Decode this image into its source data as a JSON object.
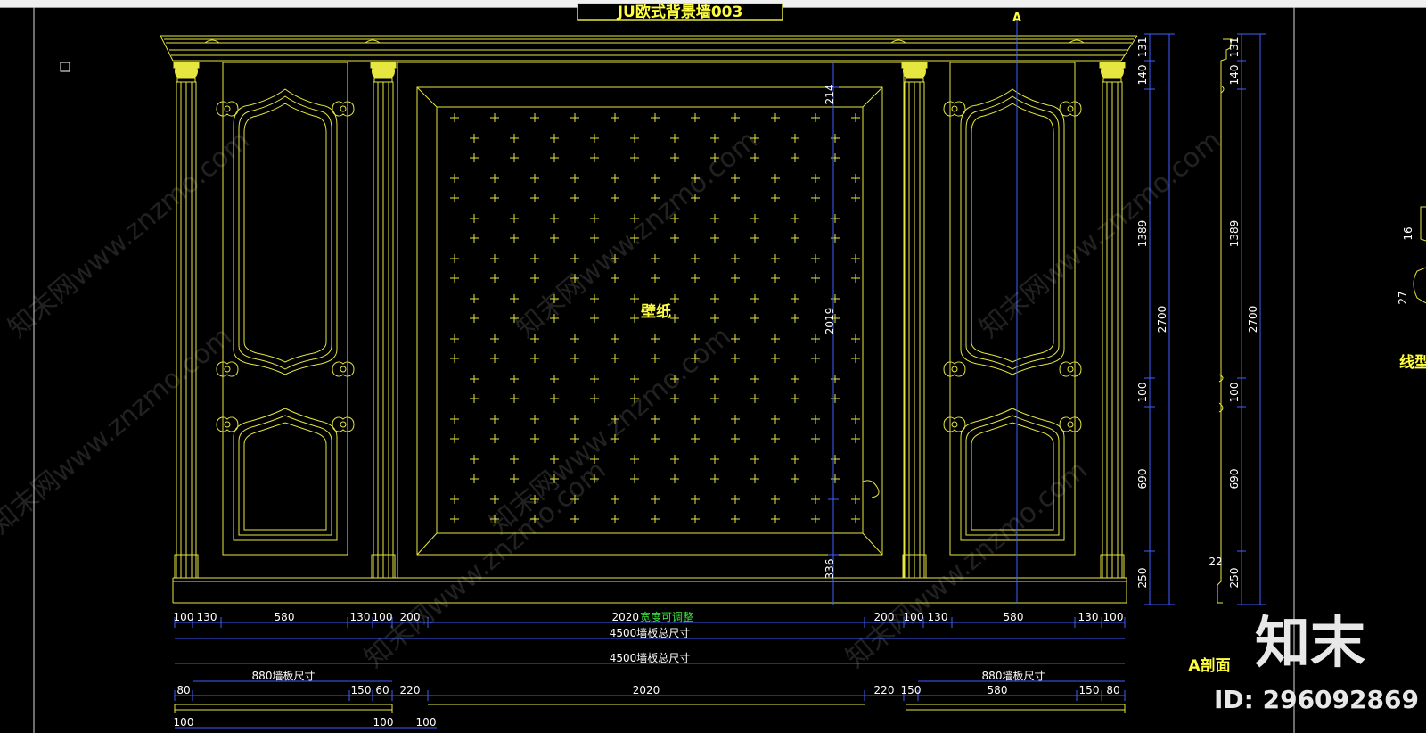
{
  "drawing": {
    "title": "JU欧式背景墙003",
    "wallpaper_label": "壁纸",
    "section_marker": "A",
    "section_label": "A剖面",
    "profile_label": "线型",
    "width_adjustable": "宽度可调整"
  },
  "dimensions": {
    "top_row": [
      "100",
      "130",
      "580",
      "130",
      "100",
      "200",
      "2020",
      "200",
      "100",
      "130",
      "580",
      "130",
      "100"
    ],
    "total_width_1": "4500墙板总尺寸",
    "total_width_2": "4500墙板总尺寸",
    "panel_width_left": "880墙板尺寸",
    "panel_width_right": "880墙板尺寸",
    "bottom_row": [
      "80",
      "150",
      "60",
      "220",
      "2020",
      "220",
      "150",
      "580",
      "150",
      "80"
    ],
    "base_row": [
      "100",
      "100",
      "100"
    ],
    "center_vertical": [
      "214",
      "2019",
      "336"
    ],
    "right_heights": [
      "131",
      "140",
      "1389",
      "100",
      "690",
      "250"
    ],
    "right_total": "2700",
    "section_heights": [
      "131",
      "140",
      "1389",
      "100",
      "690",
      "250"
    ],
    "section_total": "2700",
    "section_small": "22",
    "profile_dims": [
      "16",
      "27"
    ]
  },
  "watermark": {
    "text": "知末网www.znzmo.com",
    "brand": "知末",
    "id": "ID: 296092869"
  },
  "colors": {
    "line": "#e6e640",
    "dim": "#4060ff",
    "text_yellow": "#ffff40",
    "text_green": "#3ce63c",
    "background": "#000000"
  }
}
